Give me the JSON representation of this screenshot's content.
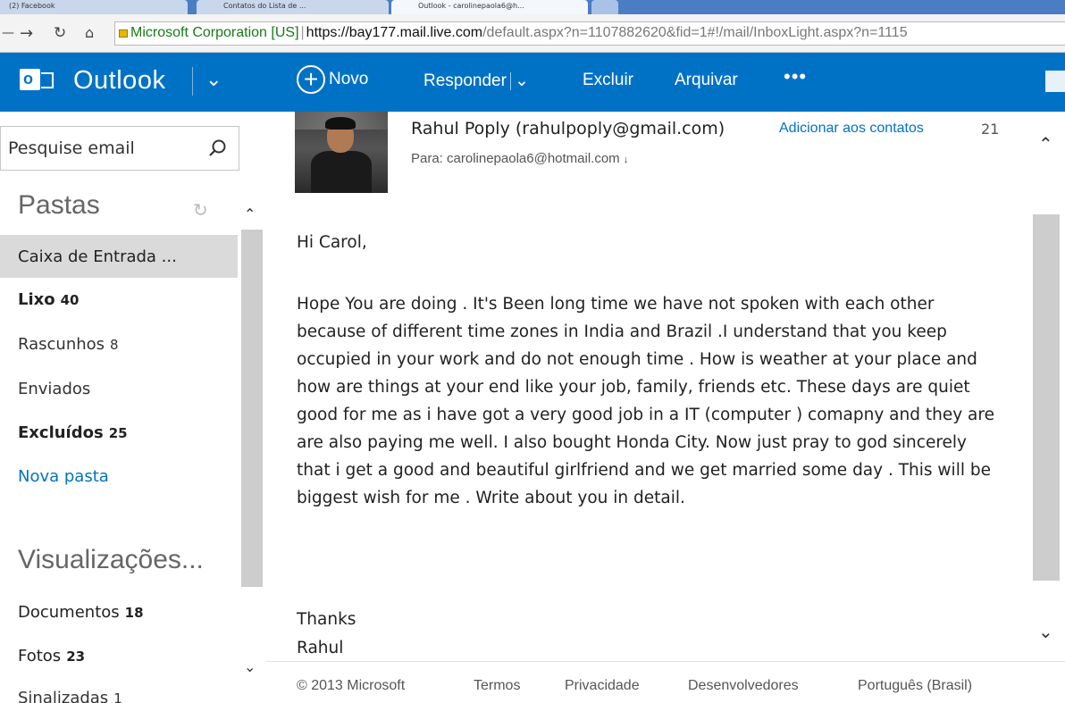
{
  "browser": {
    "tabs": [
      {
        "label": "(2) Facebook"
      },
      {
        "label": "Contatos do Lista de ..."
      },
      {
        "label": "Outlook - carolinepaola6@h..."
      },
      {
        "label": ""
      }
    ],
    "ev_label": "Microsoft Corporation [US]",
    "url_scheme": "https://",
    "url_host": "bay177.mail.live.com",
    "url_rest": "/default.aspx?n=1107882620&fid=1#!/mail/InboxLight.aspx?n=1115"
  },
  "header": {
    "brand": "Outlook",
    "new_label": "Novo",
    "reply_label": "Responder",
    "delete_label": "Excluir",
    "archive_label": "Arquivar",
    "more_label": "•••",
    "brand_color": "#0072c6"
  },
  "sidebar": {
    "search_placeholder": "Pesquise email",
    "folders_heading": "Pastas",
    "folders": [
      {
        "name": "Caixa de Entrada ...",
        "count": ""
      },
      {
        "name": "Lixo",
        "count": "40"
      },
      {
        "name": "Rascunhos",
        "count": "8"
      },
      {
        "name": "Enviados",
        "count": ""
      },
      {
        "name": "Excluídos",
        "count": "25"
      },
      {
        "name": "Nova pasta",
        "count": ""
      }
    ],
    "views_heading": "Visualizações...",
    "views": [
      {
        "name": "Documentos",
        "count": "18"
      },
      {
        "name": "Fotos",
        "count": "23"
      },
      {
        "name": "Sinalizadas",
        "count": "1"
      }
    ]
  },
  "message": {
    "sender": "Rahul Poply (rahulpoply@gmail.com)",
    "add_contact": "Adicionar aos contatos",
    "date": "21",
    "to": "Para: carolinepaola6@hotmail.com",
    "greeting": "Hi Carol,",
    "body": "Hope You are doing . It's Been long time we have not spoken with each other because of different time zones in India and Brazil .I understand that you keep occupied in your work and do not enough time . How is weather at your place and how are things at your end like your job, family, friends etc. These days are quiet good for me as i have got a very good job in a IT (computer ) comapny and they are are also paying me well. I also bought Honda City. Now just pray to god sincerely that i get a good  and beautiful girlfriend and we get married some day . This will be biggest wish for me . Write about you in detail.",
    "closing": "Thanks",
    "signature": "Rahul"
  },
  "footer": {
    "copyright": "© 2013 Microsoft",
    "terms": "Termos",
    "privacy": "Privacidade",
    "developers": "Desenvolvedores",
    "language": "Português (Brasil)"
  }
}
